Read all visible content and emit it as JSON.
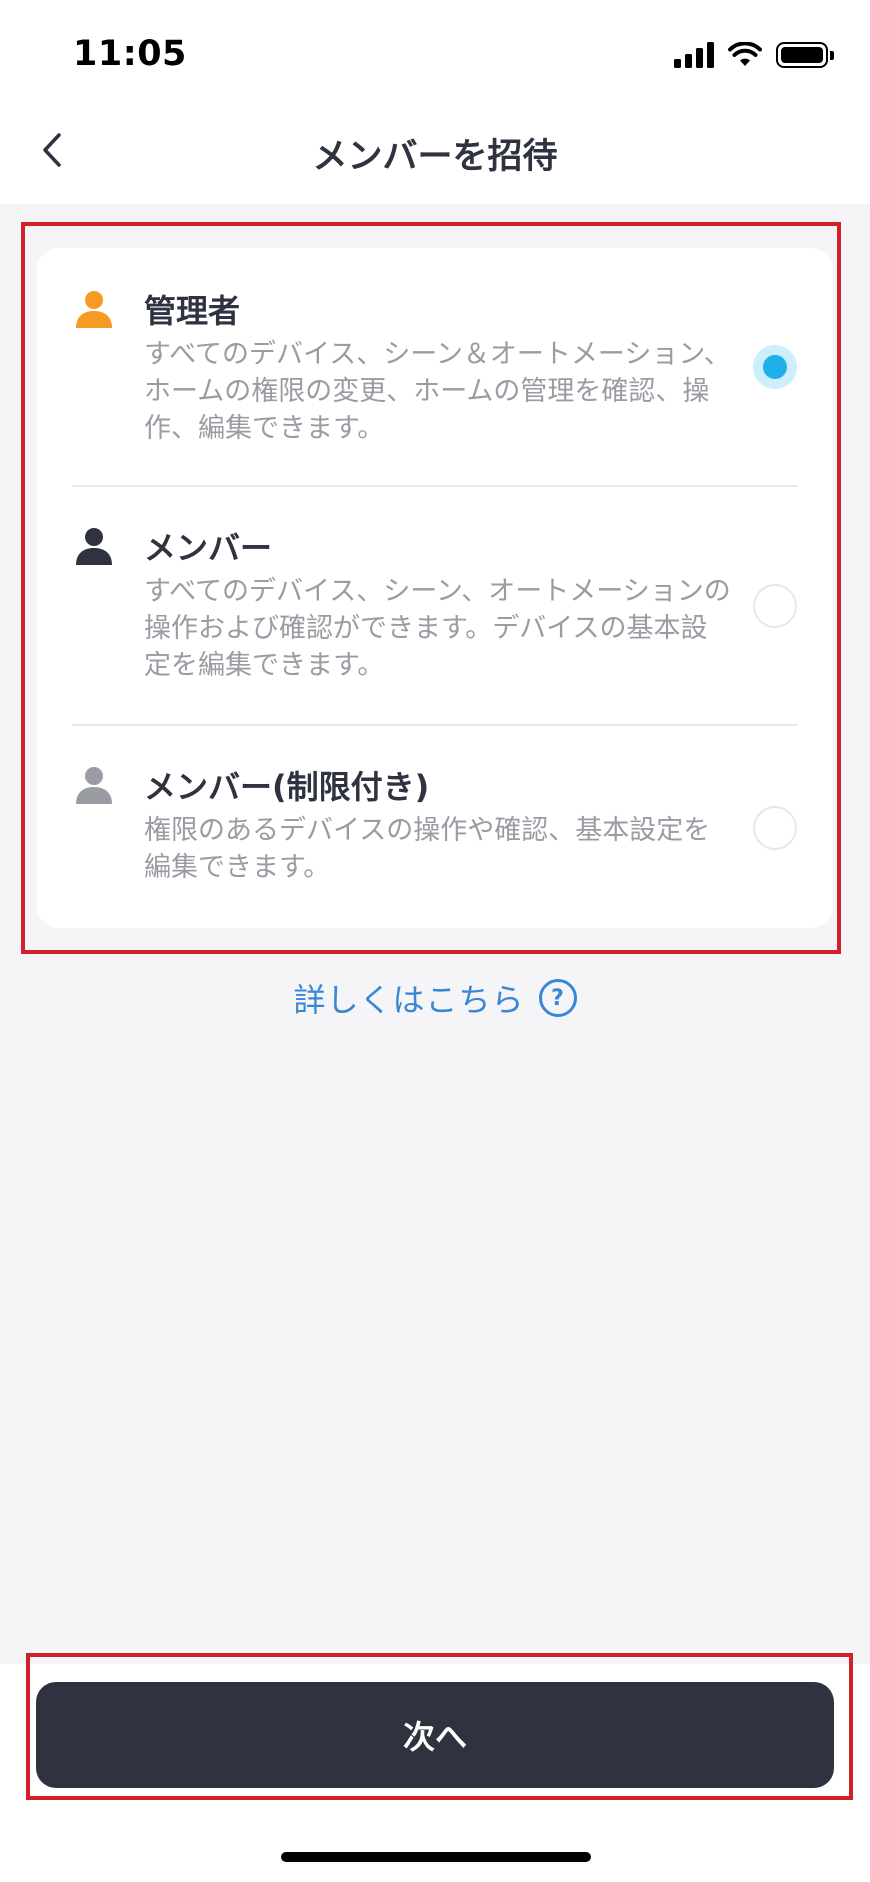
{
  "status_bar": {
    "time": "11:05"
  },
  "header": {
    "title": "メンバーを招待"
  },
  "roles": [
    {
      "title": "管理者",
      "description": "すべてのデバイス、シーン＆オートメーション、ホームの権限の変更、ホームの管理を確認、操作、編集できます。",
      "icon": "person-icon",
      "icon_color": "#f59a23",
      "selected": true
    },
    {
      "title": "メンバー",
      "description": "すべてのデバイス、シーン、オートメーションの操作および確認ができます。デバイスの基本設定を編集できます。",
      "icon": "person-icon",
      "icon_color": "#2f3340",
      "selected": false
    },
    {
      "title": "メンバー(制限付き)",
      "description": "権限のあるデバイスの操作や確認、基本設定を編集できます。",
      "icon": "person-icon",
      "icon_color": "#9a9ca3",
      "selected": false
    }
  ],
  "learn_more": {
    "label": "詳しくはこちら",
    "icon": "question-circle-icon"
  },
  "footer": {
    "next_label": "次へ"
  },
  "colors": {
    "accent": "#1fb0ec",
    "link": "#3a86d6",
    "primary_button": "#2f3340",
    "highlight": "#d0202a"
  }
}
